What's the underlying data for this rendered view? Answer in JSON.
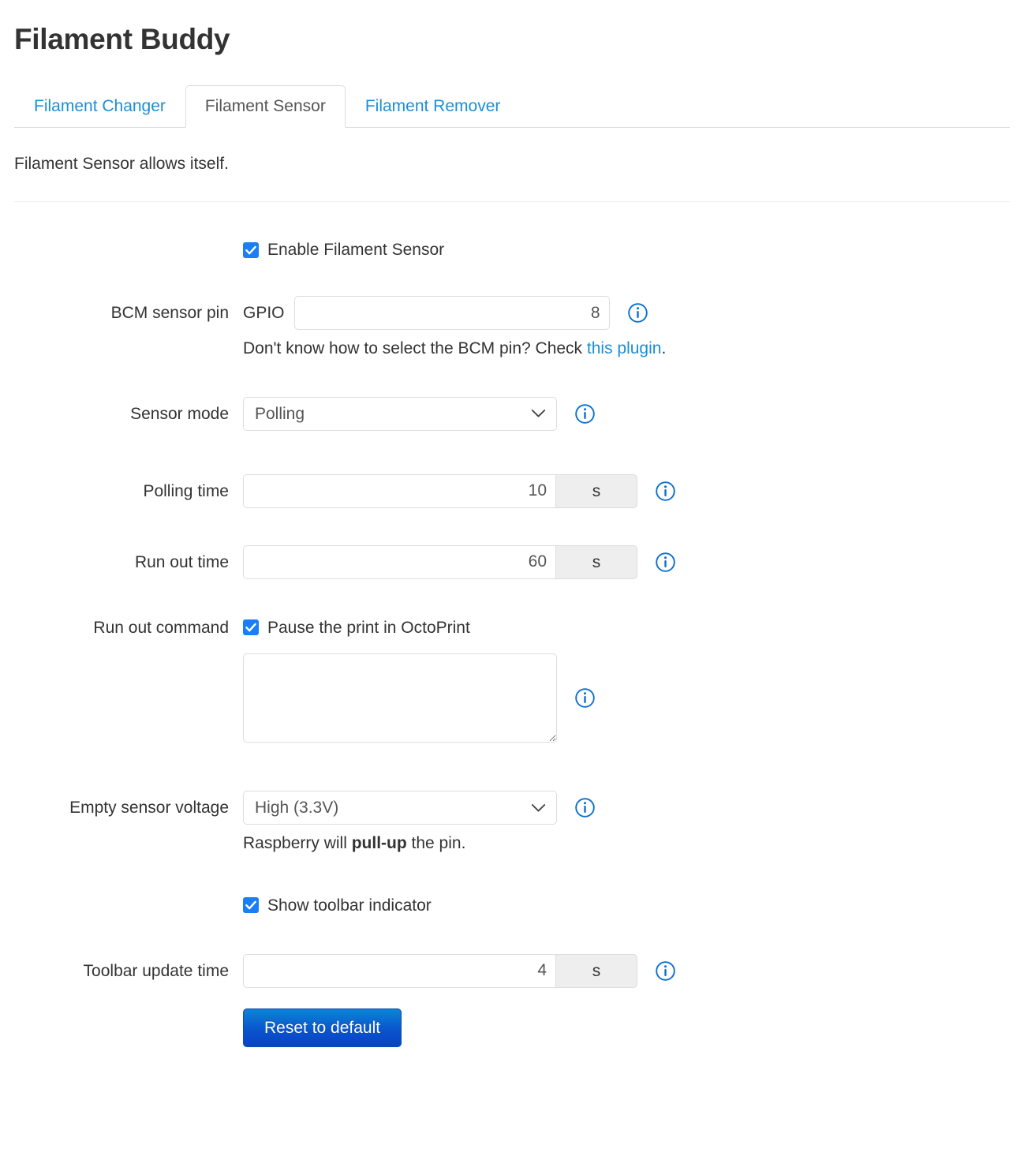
{
  "header": {
    "title": "Filament Buddy"
  },
  "tabs": [
    {
      "label": "Filament Changer",
      "active": false
    },
    {
      "label": "Filament Sensor",
      "active": true
    },
    {
      "label": "Filament Remover",
      "active": false
    }
  ],
  "description": "Filament Sensor allows itself.",
  "icons": {
    "info": "info-circle-icon",
    "chevron": "chevron-down-icon",
    "check": "check-icon"
  },
  "colors": {
    "link": "#1a8fd8",
    "checkbox": "#1a7ff5",
    "info_icon": "#0a6fcf",
    "button_top": "#0b84d6",
    "button_bottom": "#0844c4"
  },
  "form": {
    "enable_sensor": {
      "label": "Enable Filament Sensor",
      "checked": true
    },
    "bcm_sensor_pin": {
      "label": "BCM sensor pin",
      "prefix": "GPIO",
      "value": "8",
      "help_prefix": "Don't know how to select the BCM pin? Check ",
      "help_link": "this plugin",
      "help_suffix": "."
    },
    "sensor_mode": {
      "label": "Sensor mode",
      "value": "Polling",
      "options": [
        "Polling"
      ]
    },
    "polling_time": {
      "label": "Polling time",
      "value": "10",
      "unit": "s"
    },
    "run_out_time": {
      "label": "Run out time",
      "value": "60",
      "unit": "s"
    },
    "run_out_command": {
      "label": "Run out command",
      "checkbox_label": "Pause the print in OctoPrint",
      "checked": true,
      "textarea_value": "",
      "textarea_placeholder": ""
    },
    "empty_sensor_voltage": {
      "label": "Empty sensor voltage",
      "value": "High (3.3V)",
      "options": [
        "High (3.3V)"
      ],
      "help_prefix": "Raspberry will ",
      "help_bold": "pull-up",
      "help_suffix": " the pin."
    },
    "show_toolbar_indicator": {
      "label": "Show toolbar indicator",
      "checked": true
    },
    "toolbar_update_time": {
      "label": "Toolbar update time",
      "value": "4",
      "unit": "s"
    },
    "reset_button": {
      "label": "Reset to default"
    }
  }
}
